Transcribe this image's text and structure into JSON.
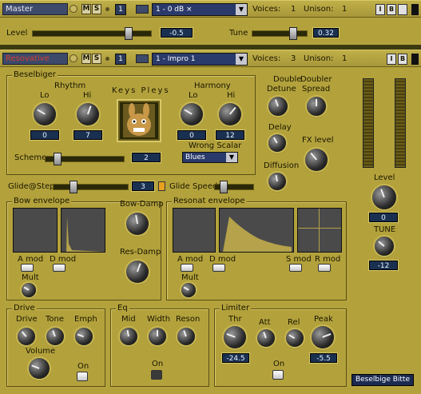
{
  "master": {
    "name": "Master",
    "m": "M",
    "s": "S",
    "slot": "1",
    "preset": "1 - 0 dB ×",
    "voices_label": "Voices:",
    "voices": "1",
    "unison_label": "Unison:",
    "unison": "1",
    "level_label": "Level",
    "level_value": "-0.5",
    "tune_label": "Tune",
    "tune_value": "0.32"
  },
  "inst": {
    "name": "Resovative",
    "m": "M",
    "s": "S",
    "slot": "1",
    "preset": "1 - Impro 1",
    "voices_label": "Voices:",
    "voices": "3",
    "unison_label": "Unison:",
    "unison": "1"
  },
  "top_buttons": {
    "i": "I",
    "b": "B"
  },
  "beselbiger": {
    "title": "Beselbiger",
    "rhythm": "Rhythm",
    "lo": "Lo",
    "hi": "Hi",
    "rhythm_lo": "0",
    "rhythm_hi": "7",
    "keys": "Keys Pleys",
    "harmony": "Harmony",
    "h_lo": "Lo",
    "h_hi": "Hi",
    "harm_lo": "0",
    "harm_hi": "12",
    "scheme": "Scheme",
    "scheme_val": "2",
    "wrong_scalar": "Wrong Scalar",
    "scale": "Blues"
  },
  "fx": {
    "double_detune": [
      "Double",
      "Detune"
    ],
    "doubler_spread": [
      "Doubler",
      "Spread"
    ],
    "delay": "Delay",
    "fx_level": "FX level",
    "diffusion": "Diffusion"
  },
  "glide": {
    "glide_step": "Glide@Step",
    "glide_step_val": "3",
    "glide_speed": "Glide Speed"
  },
  "bow": {
    "title": "Bow envelope",
    "a_mod": "A mod",
    "d_mod": "D mod",
    "mult": "Mult",
    "bow_damp": "Bow-Damp",
    "res_damp": "Res-Damp"
  },
  "reso": {
    "title": "Resonat envelope",
    "a_mod": "A mod",
    "d_mod": "D mod",
    "s_mod": "S mod",
    "r_mod": "R mod",
    "mult": "Mult"
  },
  "out": {
    "level": "Level",
    "level_val": "0",
    "tune": "TUNE",
    "tune_val": "-12"
  },
  "drive": {
    "title": "Drive",
    "drive": "Drive",
    "tone": "Tone",
    "emph": "Emph",
    "volume": "Volume",
    "on": "On"
  },
  "eq": {
    "title": "Eq",
    "mid": "Mid",
    "width": "Width",
    "reson": "Reson",
    "on": "On"
  },
  "limiter": {
    "title": "Limiter",
    "thr": "Thr",
    "att": "Att",
    "rel": "Rel",
    "peak": "Peak",
    "thr_val": "-24.5",
    "peak_val": "-5.5",
    "on": "On"
  },
  "footer": "Beselbige Bitte"
}
